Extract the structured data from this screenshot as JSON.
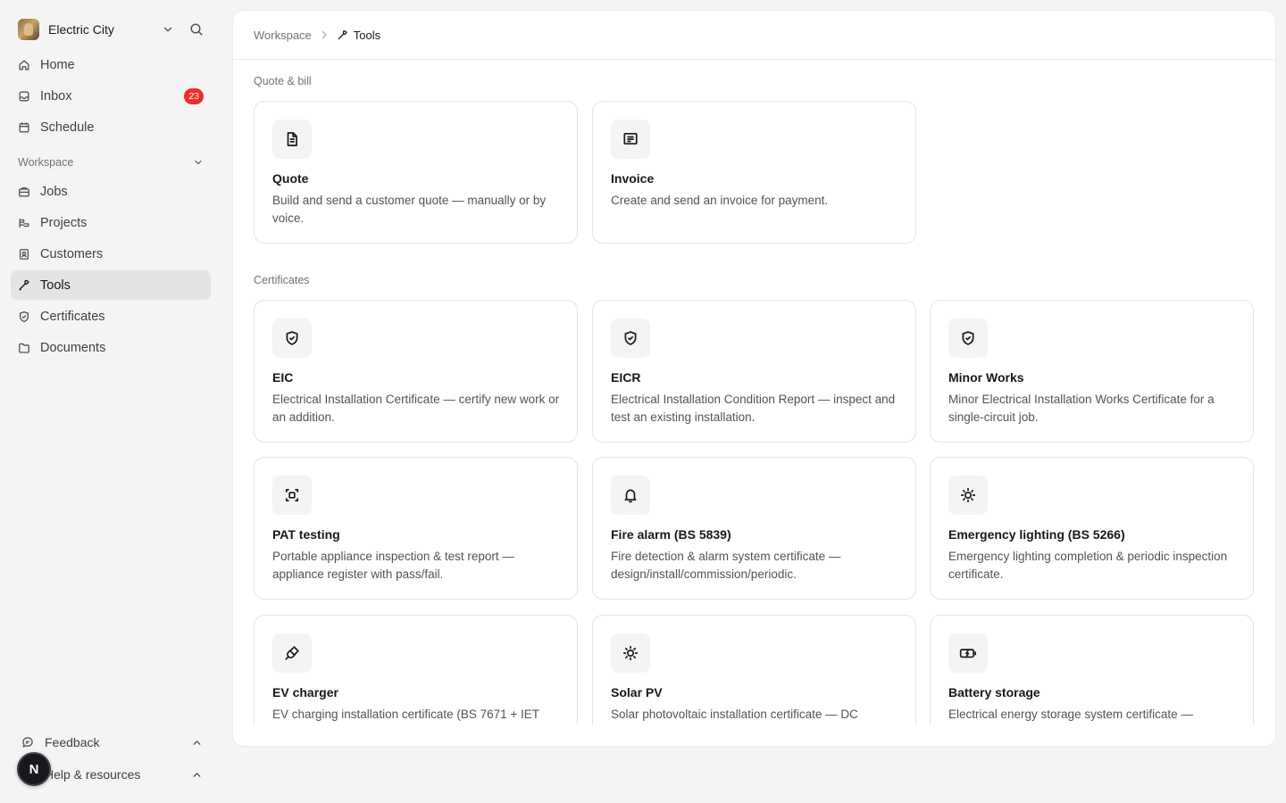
{
  "workspace": {
    "name": "Electric City"
  },
  "nav_top": [
    {
      "label": "Home",
      "icon": "home-icon"
    },
    {
      "label": "Inbox",
      "icon": "inbox-icon",
      "badge": "23"
    },
    {
      "label": "Schedule",
      "icon": "calendar-icon"
    }
  ],
  "workspace_section": {
    "label": "Workspace"
  },
  "nav_workspace": [
    {
      "label": "Jobs",
      "icon": "briefcase-icon"
    },
    {
      "label": "Projects",
      "icon": "projects-icon"
    },
    {
      "label": "Customers",
      "icon": "contacts-icon"
    },
    {
      "label": "Tools",
      "icon": "tools-icon",
      "active": true
    },
    {
      "label": "Certificates",
      "icon": "shield-icon"
    },
    {
      "label": "Documents",
      "icon": "folder-icon"
    }
  ],
  "footer": {
    "feedback": "Feedback",
    "help": "Help & resources",
    "user_initial": "N"
  },
  "breadcrumb": {
    "parent": "Workspace",
    "current": "Tools"
  },
  "groups": {
    "quote_bill": {
      "title": "Quote & bill",
      "cards": [
        {
          "title": "Quote",
          "desc": "Build and send a customer quote — manually or by voice.",
          "icon": "document-icon"
        },
        {
          "title": "Invoice",
          "desc": "Create and send an invoice for payment.",
          "icon": "receipt-icon"
        }
      ]
    },
    "certificates": {
      "title": "Certificates",
      "cards": [
        {
          "title": "EIC",
          "desc": "Electrical Installation Certificate — certify new work or an addition.",
          "icon": "shield-check-icon"
        },
        {
          "title": "EICR",
          "desc": "Electrical Installation Condition Report — inspect and test an existing installation.",
          "icon": "shield-check-icon"
        },
        {
          "title": "Minor Works",
          "desc": "Minor Electrical Installation Works Certificate for a single-circuit job.",
          "icon": "shield-check-icon"
        },
        {
          "title": "PAT testing",
          "desc": "Portable appliance inspection & test report — appliance register with pass/fail.",
          "icon": "scan-icon"
        },
        {
          "title": "Fire alarm (BS 5839)",
          "desc": "Fire detection & alarm system certificate — design/install/commission/periodic.",
          "icon": "bell-icon"
        },
        {
          "title": "Emergency lighting (BS 5266)",
          "desc": "Emergency lighting completion & periodic inspection certificate.",
          "icon": "sun-icon"
        },
        {
          "title": "EV charger",
          "desc": "EV charging installation certificate (BS 7671 + IET",
          "icon": "plug-icon"
        },
        {
          "title": "Solar PV",
          "desc": "Solar photovoltaic installation certificate — DC",
          "icon": "sun-icon"
        },
        {
          "title": "Battery storage",
          "desc": "Electrical energy storage system certificate —",
          "icon": "battery-icon"
        }
      ]
    }
  }
}
